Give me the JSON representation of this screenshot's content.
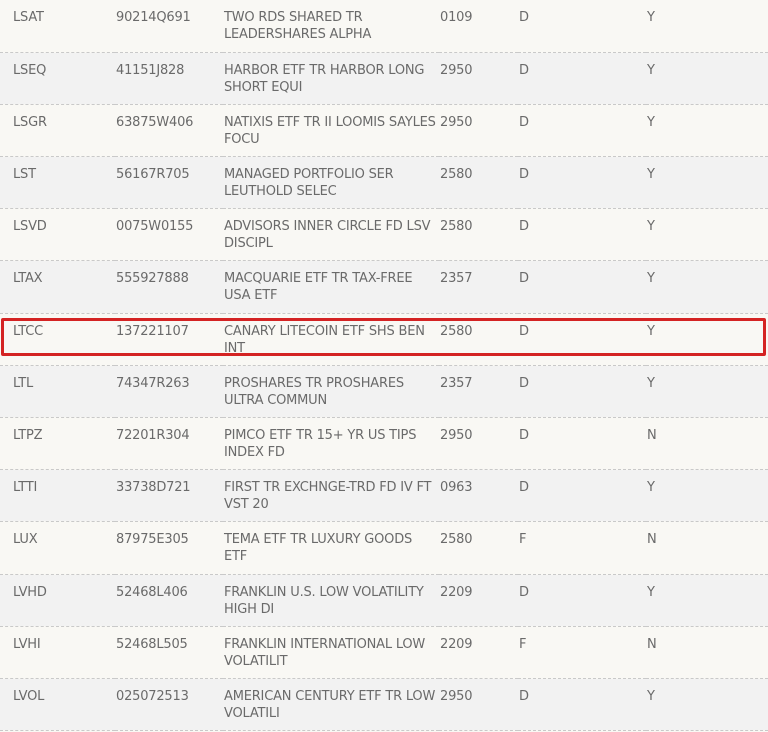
{
  "table": {
    "rows": [
      {
        "symbol": "LSAT",
        "cusip": "90214Q691",
        "name": "TWO RDS SHARED TR LEADERSHARES ALPHA",
        "code": "0109",
        "type": "D",
        "flag": "Y"
      },
      {
        "symbol": "LSEQ",
        "cusip": "41151J828",
        "name": "HARBOR ETF TR HARBOR LONG SHORT EQUI",
        "code": "2950",
        "type": "D",
        "flag": "Y"
      },
      {
        "symbol": "LSGR",
        "cusip": "63875W406",
        "name": "NATIXIS ETF TR II LOOMIS SAYLES FOCU",
        "code": "2950",
        "type": "D",
        "flag": "Y"
      },
      {
        "symbol": "LST",
        "cusip": "56167R705",
        "name": "MANAGED PORTFOLIO SER LEUTHOLD SELEC",
        "code": "2580",
        "type": "D",
        "flag": "Y"
      },
      {
        "symbol": "LSVD",
        "cusip": "0075W0155",
        "name": "ADVISORS INNER CIRCLE FD LSV DISCIPL",
        "code": "2580",
        "type": "D",
        "flag": "Y"
      },
      {
        "symbol": "LTAX",
        "cusip": "555927888",
        "name": "MACQUARIE ETF TR TAX-FREE USA ETF",
        "code": "2357",
        "type": "D",
        "flag": "Y"
      },
      {
        "symbol": "LTCC",
        "cusip": "137221107",
        "name": "CANARY LITECOIN ETF SHS BEN INT",
        "code": "2580",
        "type": "D",
        "flag": "Y",
        "highlighted": true
      },
      {
        "symbol": "LTL",
        "cusip": "74347R263",
        "name": "PROSHARES TR PROSHARES ULTRA COMMUN",
        "code": "2357",
        "type": "D",
        "flag": "Y"
      },
      {
        "symbol": "LTPZ",
        "cusip": "72201R304",
        "name": "PIMCO ETF TR 15+ YR US TIPS INDEX FD",
        "code": "2950",
        "type": "D",
        "flag": "N"
      },
      {
        "symbol": "LTTI",
        "cusip": "33738D721",
        "name": "FIRST TR EXCHNGE-TRD FD IV FT VST 20",
        "code": "0963",
        "type": "D",
        "flag": "Y"
      },
      {
        "symbol": "LUX",
        "cusip": "87975E305",
        "name": "TEMA ETF TR LUXURY GOODS ETF",
        "code": "2580",
        "type": "F",
        "flag": "N"
      },
      {
        "symbol": "LVHD",
        "cusip": "52468L406",
        "name": "FRANKLIN U.S. LOW VOLATILITY HIGH DI",
        "code": "2209",
        "type": "D",
        "flag": "Y"
      },
      {
        "symbol": "LVHI",
        "cusip": "52468L505",
        "name": "FRANKLIN INTERNATIONAL LOW VOLATILIT",
        "code": "2209",
        "type": "F",
        "flag": "N"
      },
      {
        "symbol": "LVOL",
        "cusip": "025072513",
        "name": "AMERICAN CENTURY ETF TR LOW VOLATILI",
        "code": "2950",
        "type": "D",
        "flag": "Y"
      }
    ]
  },
  "colors": {
    "row_odd": "#f9f8f4",
    "row_even": "#f2f2f2",
    "text": "#6a6a6a",
    "highlight": "#d42323"
  }
}
